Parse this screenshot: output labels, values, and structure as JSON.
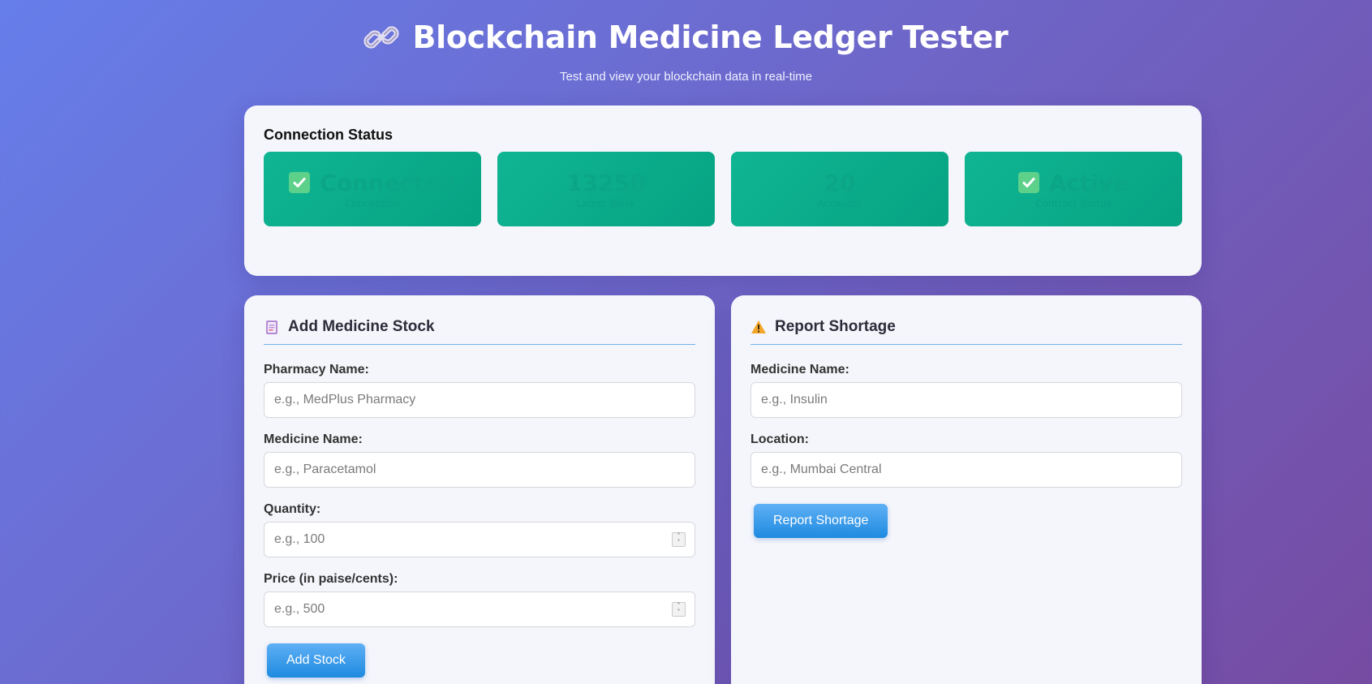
{
  "header": {
    "title": "Blockchain Medicine Ledger Tester",
    "subtitle": "Test and view your blockchain data in real-time"
  },
  "status": {
    "title": "Connection Status",
    "tiles": [
      {
        "value": "Connected",
        "label": "Connection",
        "icon": "check-icon"
      },
      {
        "value": "13250",
        "label": "Latest Block"
      },
      {
        "value": "20",
        "label": "Accounts"
      },
      {
        "value": "Active",
        "label": "Contract Status",
        "icon": "check-icon"
      }
    ]
  },
  "add_stock": {
    "title": "Add Medicine Stock",
    "icon": "memo-icon",
    "fields": {
      "pharmacy": {
        "label": "Pharmacy Name:",
        "placeholder": "e.g., MedPlus Pharmacy"
      },
      "medicine": {
        "label": "Medicine Name:",
        "placeholder": "e.g., Paracetamol"
      },
      "quantity": {
        "label": "Quantity:",
        "placeholder": "e.g., 100"
      },
      "price": {
        "label": "Price (in paise/cents):",
        "placeholder": "e.g., 500"
      }
    },
    "button": "Add Stock"
  },
  "shortage": {
    "title": "Report Shortage",
    "icon": "warning-icon",
    "fields": {
      "medicine": {
        "label": "Medicine Name:",
        "placeholder": "e.g., Insulin"
      },
      "location": {
        "label": "Location:",
        "placeholder": "e.g., Mumbai Central"
      }
    },
    "button": "Report Shortage"
  },
  "colors": {
    "background_start": "#667eea",
    "background_end": "#764ba2",
    "tile": "#10b593",
    "button": "#1e8ae0"
  }
}
